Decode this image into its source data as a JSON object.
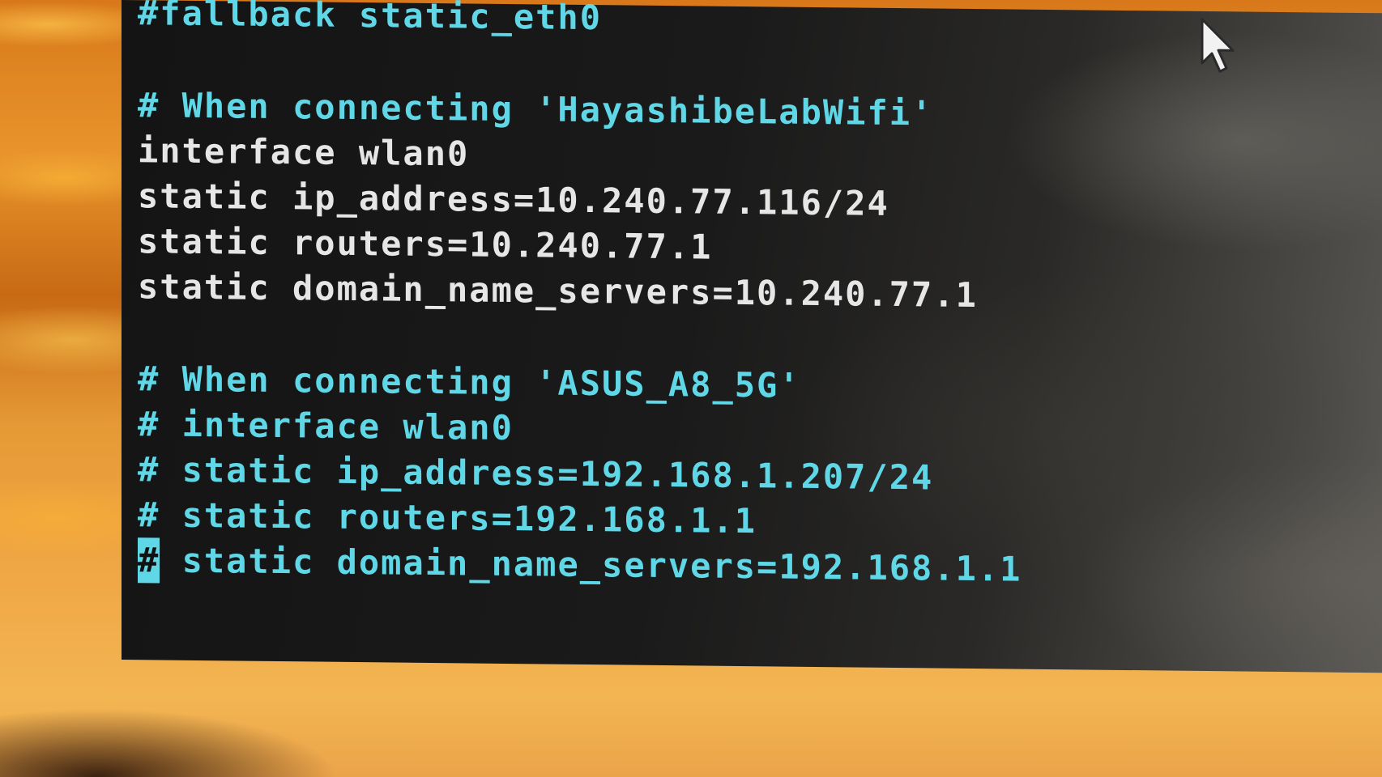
{
  "terminal": {
    "lines": [
      {
        "text": "#fallback static_eth0",
        "style": "comment"
      },
      {
        "text": "",
        "style": "plain"
      },
      {
        "text": "# When connecting 'HayashibeLabWifi'",
        "style": "comment"
      },
      {
        "text": "interface wlan0",
        "style": "plain"
      },
      {
        "text": "static ip_address=10.240.77.116/24",
        "style": "plain"
      },
      {
        "text": "static routers=10.240.77.1",
        "style": "plain"
      },
      {
        "text": "static domain_name_servers=10.240.77.1",
        "style": "plain"
      },
      {
        "text": "",
        "style": "plain"
      },
      {
        "text": "# When connecting 'ASUS_A8_5G'",
        "style": "comment"
      },
      {
        "text": "# interface wlan0",
        "style": "comment"
      },
      {
        "text": "# static ip_address=192.168.1.207/24",
        "style": "comment"
      },
      {
        "text": "# static routers=192.168.1.1",
        "style": "comment"
      },
      {
        "text": "static domain_name_servers=192.168.1.1",
        "style": "comment",
        "cursor": "#"
      }
    ]
  },
  "colors": {
    "comment": "#5fd7e6",
    "plain": "#e6e6e6",
    "terminal_bg": "#1a1a1a"
  },
  "icons": {
    "mouse_pointer": "arrow-pointer-icon"
  }
}
